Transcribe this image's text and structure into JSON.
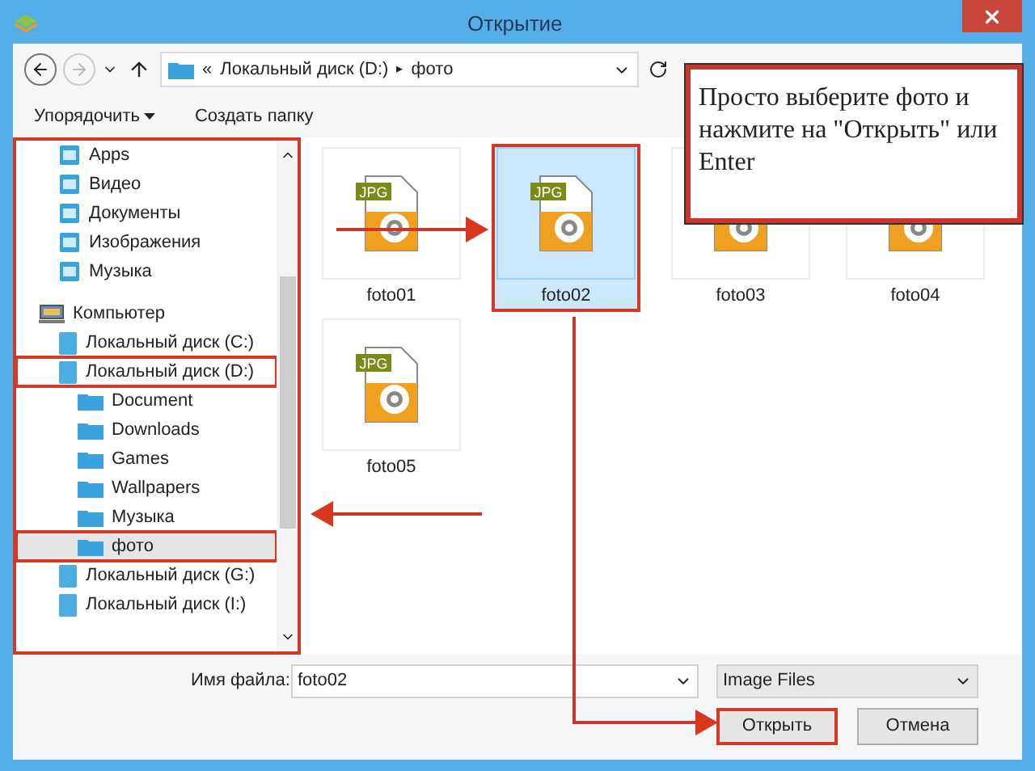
{
  "window": {
    "title": "Открытие"
  },
  "address": {
    "overflow": "«",
    "parts": [
      "Локальный диск (D:)",
      "фото"
    ],
    "separator": "▸"
  },
  "toolbar": {
    "organize": "Упорядочить",
    "new_folder": "Создать папку"
  },
  "sidebar": {
    "items": [
      {
        "label": "Apps",
        "selected": false,
        "highlighted": false
      },
      {
        "label": "Видео",
        "selected": false,
        "highlighted": false
      },
      {
        "label": "Документы",
        "selected": false,
        "highlighted": false
      },
      {
        "label": "Изображения",
        "selected": false,
        "highlighted": false
      },
      {
        "label": "Музыка",
        "selected": false,
        "highlighted": false
      },
      {
        "label": "Компьютер",
        "selected": false,
        "highlighted": false,
        "children": [
          {
            "label": "Локальный диск (C:)",
            "selected": false,
            "highlighted": false
          },
          {
            "label": "Локальный диск (D:)",
            "selected": false,
            "highlighted": true,
            "children": [
              {
                "label": "Document",
                "selected": false,
                "highlighted": false
              },
              {
                "label": "Downloads",
                "selected": false,
                "highlighted": false
              },
              {
                "label": "Games",
                "selected": false,
                "highlighted": false
              },
              {
                "label": "Wallpapers",
                "selected": false,
                "highlighted": false
              },
              {
                "label": "Музыка",
                "selected": false,
                "highlighted": false
              },
              {
                "label": "фото",
                "selected": true,
                "highlighted": true
              }
            ]
          },
          {
            "label": "Локальный диск (G:)",
            "selected": false,
            "highlighted": false
          },
          {
            "label": "Локальный диск (I:)",
            "selected": false,
            "highlighted": false
          }
        ]
      }
    ]
  },
  "files": [
    {
      "name": "foto01",
      "badge": "JPG",
      "selected": false
    },
    {
      "name": "foto02",
      "badge": "JPG",
      "selected": true
    },
    {
      "name": "foto03",
      "selected": false
    },
    {
      "name": "foto04",
      "selected": false
    },
    {
      "name": "foto05",
      "badge": "JPG",
      "selected": false
    }
  ],
  "filename": {
    "label": "Имя файла:",
    "value": "foto02"
  },
  "filetype": {
    "value": "Image Files"
  },
  "buttons": [
    {
      "label": "Открыть",
      "highlighted": true
    },
    {
      "label": "Отмена",
      "highlighted": false
    }
  ],
  "callout": {
    "text": "Просто выберите фото и нажмите на \"Открыть\" или Enter"
  }
}
